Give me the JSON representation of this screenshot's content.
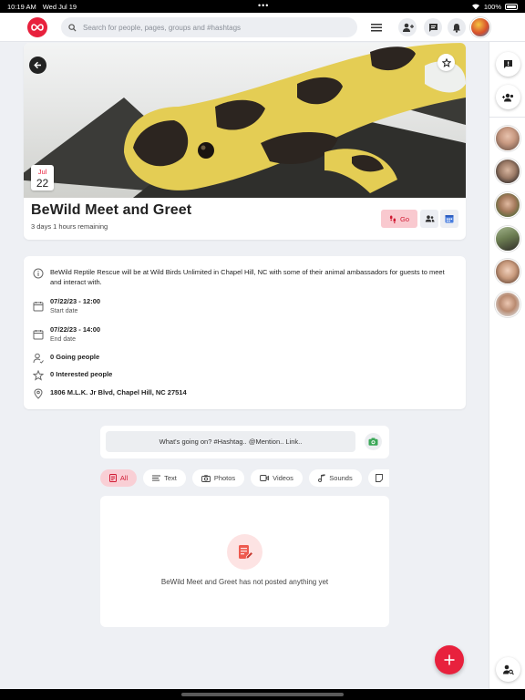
{
  "status_bar": {
    "time": "10:19 AM",
    "date": "Wed Jul 19",
    "battery": "100%"
  },
  "search": {
    "placeholder": "Search for people, pages, groups and #hashtags"
  },
  "event": {
    "month": "Jul",
    "day": "22",
    "title": "BeWild Meet and Greet",
    "remaining": "3 days 1 hours remaining",
    "go_label": "Go",
    "description": "BeWild Reptile Rescue will be at Wild Birds Unlimited in Chapel Hill, NC with some of their animal ambassadors for guests to meet and interact with.",
    "start_value": "07/22/23 - 12:00",
    "start_label": "Start date",
    "end_value": "07/22/23 - 14:00",
    "end_label": "End date",
    "going": "0 Going people",
    "interested": "0 Interested people",
    "address": "1806 M.L.K. Jr Blvd, Chapel Hill, NC 27514"
  },
  "composer": {
    "placeholder": "What's going on? #Hashtag.. @Mention.. Link.."
  },
  "filters": [
    {
      "label": "All"
    },
    {
      "label": "Text"
    },
    {
      "label": "Photos"
    },
    {
      "label": "Videos"
    },
    {
      "label": "Sounds"
    }
  ],
  "feed": {
    "empty_text": "BeWild Meet and Greet has not posted anything yet"
  },
  "colors": {
    "accent": "#e8213d",
    "accent_soft": "#f9c9cf",
    "background": "#eef0f4"
  },
  "icons": {
    "logo": "infinity-logo-icon",
    "search": "search-icon",
    "menu": "hamburger-menu-icon",
    "add_friend": "person-add-icon",
    "messages": "chat-icon",
    "notifications": "bell-icon",
    "back": "arrow-left-icon",
    "star": "star-icon",
    "go": "footsteps-icon",
    "invite": "people-add-icon",
    "calendar": "calendar-icon",
    "info": "info-icon",
    "person": "person-outline-icon",
    "location": "location-pin-icon",
    "camera": "camera-icon",
    "edit": "document-edit-icon",
    "fab": "plus-icon",
    "search_people": "person-search-icon"
  }
}
